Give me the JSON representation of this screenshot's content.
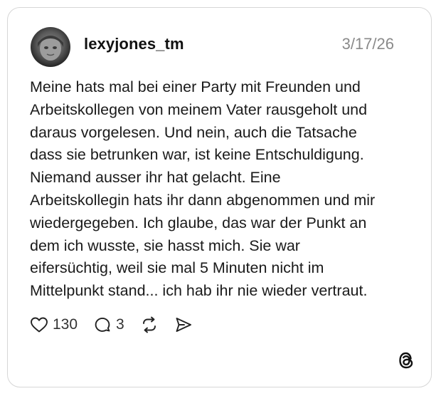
{
  "post": {
    "username": "lexyjones_tm",
    "date": "3/17/26",
    "text": "Meine hats mal bei einer Party mit Freunden und\nArbeitskollegen von meinem Vater rausgeholt und\ndaraus vorgelesen. Und nein, auch die Tatsache\ndass sie betrunken war, ist keine Entschuldigung.\nNiemand ausser ihr hat gelacht. Eine\nArbeitskollegin hats ihr dann abgenommen und mir\nwiedergegeben. Ich glaube, das war der Punkt an\ndem ich wusste, sie hasst mich. Sie war\neifersüchtig, weil sie mal 5 Minuten nicht im\nMittelpunkt stand... ich hab ihr nie wieder vertraut."
  },
  "actions": {
    "likes": "130",
    "replies": "3"
  },
  "icons": {
    "like": "heart-icon",
    "reply": "comment-bubble-icon",
    "repost": "repost-icon",
    "share": "send-icon",
    "brand": "threads-logo-icon"
  }
}
